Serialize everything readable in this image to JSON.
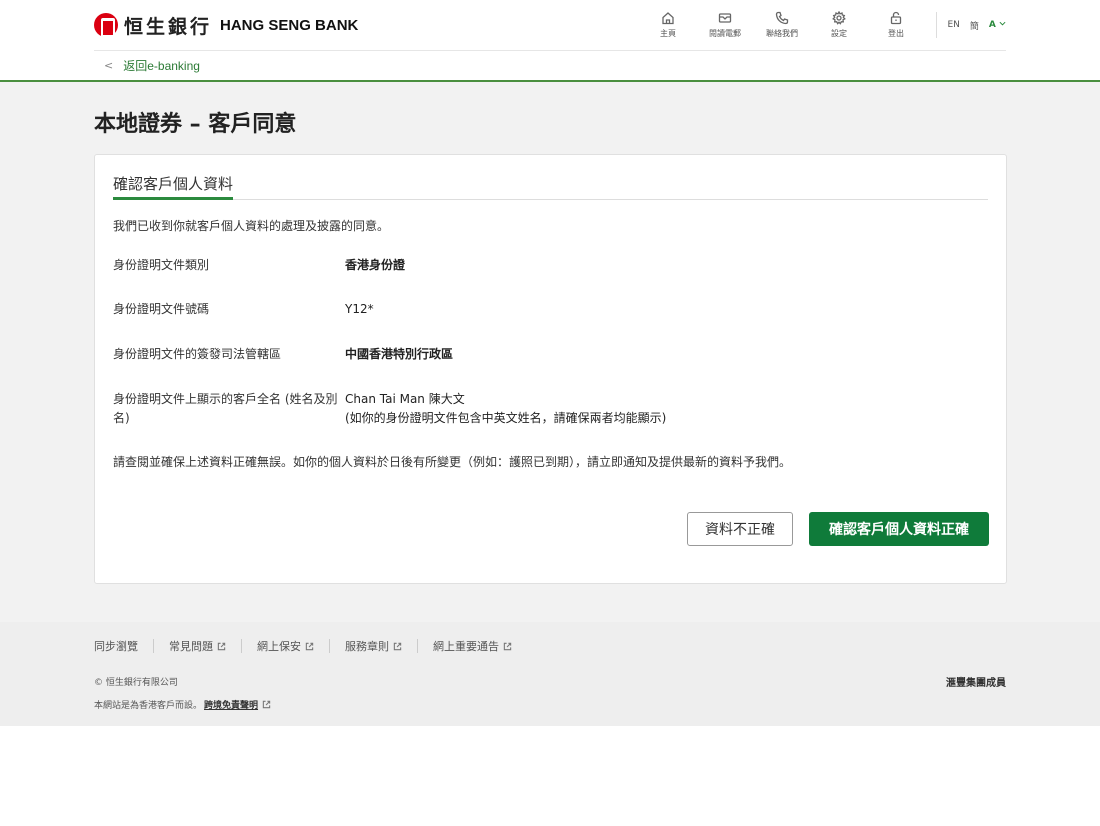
{
  "header": {
    "logo_zh": "恒生銀行",
    "logo_en": "HANG SENG BANK",
    "nav": [
      {
        "label": "主頁",
        "icon": "home-icon"
      },
      {
        "label": "閱讀電郵",
        "icon": "mail-icon"
      },
      {
        "label": "聯絡我們",
        "icon": "phone-icon"
      },
      {
        "label": "設定",
        "icon": "gear-icon"
      },
      {
        "label": "登出",
        "icon": "lock-icon"
      }
    ],
    "lang": {
      "en": "EN",
      "sc": "簡",
      "font": "A"
    },
    "back_link": "返回e-banking"
  },
  "page": {
    "title": "本地證券 – 客戶同意"
  },
  "card": {
    "title": "確認客戶個人資料",
    "intro": "我們已收到你就客戶個人資料的處理及披露的同意。",
    "rows": [
      {
        "label": "身份證明文件類別",
        "value": "香港身份證"
      },
      {
        "label": "身份證明文件號碼",
        "value": "Y12*"
      },
      {
        "label": "身份證明文件的簽發司法管轄區",
        "value": "中國香港特別行政區"
      },
      {
        "label": "身份證明文件上顯示的客戶全名 (姓名及別名)",
        "value": "Chan Tai Man 陳大文",
        "sub": "(如你的身份證明文件包含中英文姓名，請確保兩者均能顯示)"
      }
    ],
    "note": "請查閱並確保上述資料正確無誤。如你的個人資料於日後有所變更（例如：護照已到期），請立即通知及提供最新的資料予我們。",
    "btn_incorrect": "資料不正確",
    "btn_confirm": "確認客戶個人資料正確"
  },
  "footer": {
    "links": [
      "同步瀏覽",
      "常見問題",
      "網上保安",
      "服務章則",
      "網上重要通告"
    ],
    "copyright": "© 恒生銀行有限公司",
    "member": "滙豐集團成員",
    "disclaimer_text": "本網站是為香港客戶而設。",
    "disclaimer_link": "跨境免責聲明"
  },
  "colors": {
    "accent": "#0f7b3a",
    "brand_red": "#db0011"
  }
}
